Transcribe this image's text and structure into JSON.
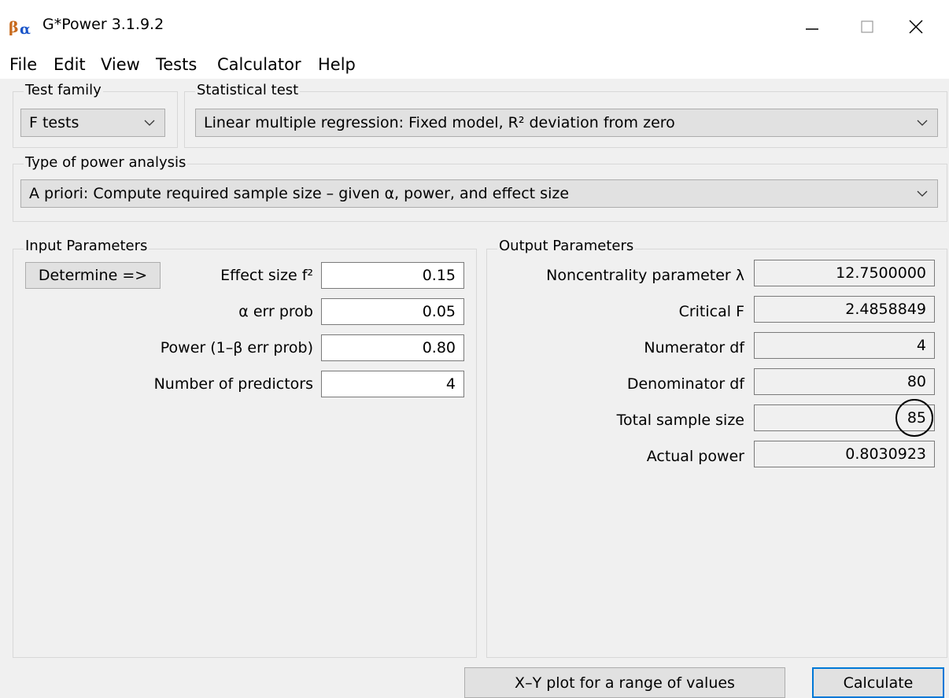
{
  "window": {
    "title": "G*Power 3.1.9.2"
  },
  "menu": [
    "File",
    "Edit",
    "View",
    "Tests",
    "Calculator",
    "Help"
  ],
  "test_family": {
    "label": "Test family",
    "value": "F tests"
  },
  "statistical_test": {
    "label": "Statistical test",
    "value": "Linear multiple regression: Fixed model, R² deviation from zero"
  },
  "power_analysis": {
    "label": "Type of power analysis",
    "value": "A priori: Compute required sample size – given α, power, and effect size"
  },
  "input": {
    "title": "Input Parameters",
    "determine_label": "Determine =>",
    "rows": [
      {
        "label": "Effect size f²",
        "value": "0.15"
      },
      {
        "label": "α err prob",
        "value": "0.05"
      },
      {
        "label": "Power (1–β err prob)",
        "value": "0.80"
      },
      {
        "label": "Number of predictors",
        "value": "4"
      }
    ]
  },
  "output": {
    "title": "Output Parameters",
    "rows": [
      {
        "label": "Noncentrality parameter λ",
        "value": "12.7500000"
      },
      {
        "label": "Critical F",
        "value": "2.4858849"
      },
      {
        "label": "Numerator df",
        "value": "4"
      },
      {
        "label": "Denominator df",
        "value": "80"
      },
      {
        "label": "Total sample size",
        "value": "85"
      },
      {
        "label": "Actual power",
        "value": "0.8030923"
      }
    ]
  },
  "buttons": {
    "xy_plot": "X–Y plot for a range of values",
    "calculate": "Calculate"
  },
  "icons": {
    "app": "gpower-beta-alpha-icon",
    "minimize": "minimize-icon",
    "maximize": "maximize-icon",
    "close": "close-icon",
    "dropdown": "chevron-down-icon"
  },
  "colors": {
    "accent_focus": "#0078d7",
    "logo_blue": "#1a55c9"
  }
}
